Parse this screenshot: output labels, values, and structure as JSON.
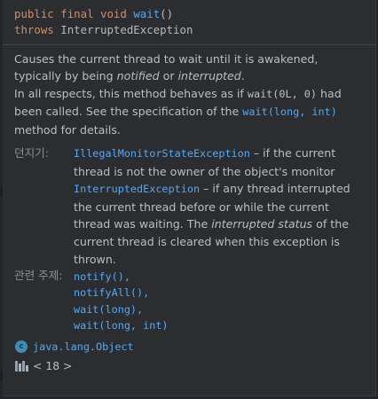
{
  "signature": {
    "kw_public": "public",
    "kw_final": "final",
    "kw_void": "void",
    "method_name": "wait",
    "parens": "()",
    "kw_throws": "throws",
    "exception": "InterruptedException"
  },
  "description": {
    "line1": "Causes the current thread to wait until it is awakened, typically by being ",
    "notified": "notified",
    "or": " or ",
    "interrupted": "interrupted",
    "period": ".",
    "line2a": "In all respects, this method behaves as if ",
    "call": "wait(0L, 0)",
    "line2b": " had been called. See the specification of the ",
    "link": "wait(long, int)",
    "line2c": " method for details."
  },
  "throws": {
    "label": "던지기:",
    "items": [
      {
        "exception": "IllegalMonitorStateException",
        "text": " – if the current thread is not the owner of the object's monitor"
      },
      {
        "exception": "InterruptedException",
        "text_a": " – if any thread interrupted the current thread before or while the current thread was waiting. The ",
        "status": "interrupted status",
        "text_b": " of the current thread is cleared when this exception is thrown."
      }
    ]
  },
  "see_also": {
    "label": "관련 주제:",
    "items": [
      "notify(),",
      "notifyAll(),",
      "wait(long),",
      "wait(long, int)"
    ]
  },
  "footer": {
    "class_icon_letter": "c",
    "class_name": "java.lang.Object",
    "jdk_text": "< 18 >"
  },
  "colors": {
    "background": "#2b2d30",
    "keyword": "#cf8e6d",
    "link": "#56a8f5",
    "text": "#bcbec4"
  },
  "icons": [
    "class-icon",
    "jdk-library-icon"
  ]
}
